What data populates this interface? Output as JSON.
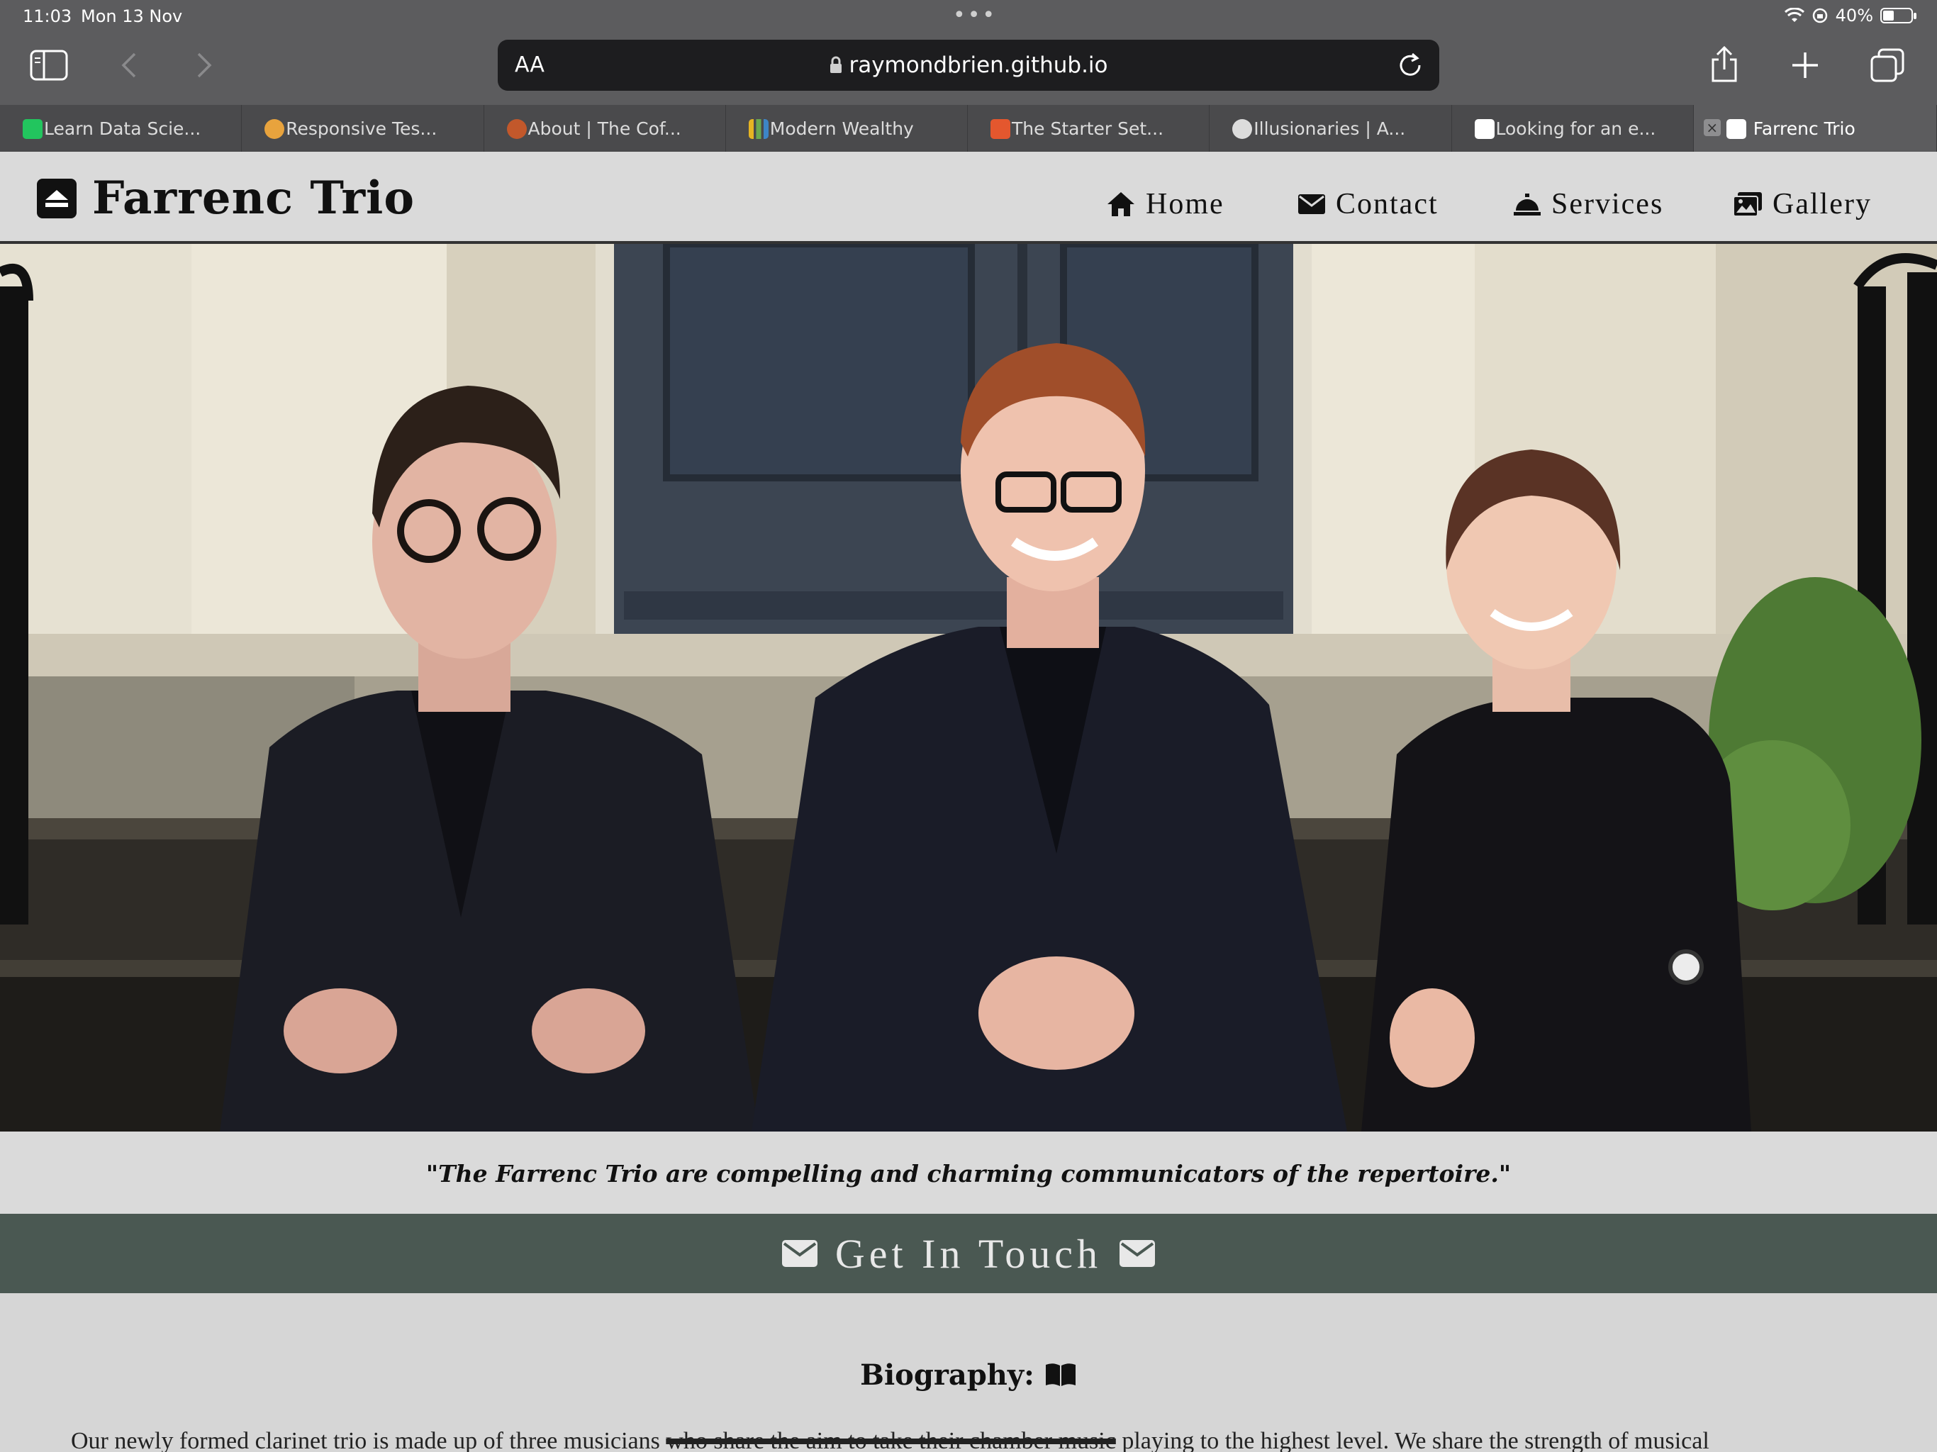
{
  "status_bar": {
    "time": "11:03",
    "date": "Mon 13 Nov",
    "battery": "40%",
    "battery_level": 0.4
  },
  "browser": {
    "url": "raymondbrien.github.io",
    "aa_label": "AA",
    "tabs": [
      {
        "label": "Learn Data Scie...",
        "icon_color": "#22c55e"
      },
      {
        "label": "Responsive Tes...",
        "icon_color": "#e8a33d"
      },
      {
        "label": "About | The Cof...",
        "icon_color": "#c2582b"
      },
      {
        "label": "Modern Wealthy",
        "icon_color": "#6aa84f"
      },
      {
        "label": "The Starter Set...",
        "icon_color": "#e4572e"
      },
      {
        "label": "Illusionaries | A...",
        "icon_color": "#333333"
      },
      {
        "label": "Looking for an e...",
        "icon_color": "#ffffff"
      },
      {
        "label": "Farrenc Trio",
        "active": true,
        "close": "×"
      }
    ]
  },
  "site": {
    "brand": "Farrenc Trio",
    "nav": [
      {
        "label": "Home",
        "icon": "home-icon"
      },
      {
        "label": "Contact",
        "icon": "envelope-icon"
      },
      {
        "label": "Services",
        "icon": "service-bell-icon"
      },
      {
        "label": "Gallery",
        "icon": "images-icon"
      }
    ],
    "quote": "\"The Farrenc Trio are compelling and charming communicators of the repertoire.\"",
    "cta": "Get In Touch",
    "bio": {
      "title": "Biography:",
      "text_before": "Our newly formed clarinet trio is made up of three musicians",
      "text_struck": "who share the aim to take their chamber music",
      "text_after": "playing to the highest level. We share the strength of musical"
    }
  }
}
